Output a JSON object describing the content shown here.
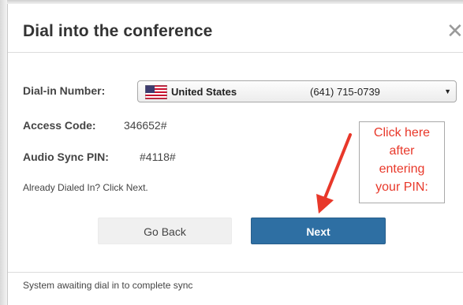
{
  "dialog": {
    "title": "Dial into the conference",
    "close_glyph": "✕",
    "dial_in_label": "Dial-in Number:",
    "dial_in": {
      "country": "United States",
      "number": "(641) 715-0739",
      "flag_icon": "us-flag-icon",
      "caret_glyph": "▼"
    },
    "access_code_label": "Access Code:",
    "access_code_value": "346652#",
    "pin_label": "Audio Sync PIN:",
    "pin_value": "#4118#",
    "hint": "Already Dialed In? Click Next.",
    "back_label": "Go Back",
    "next_label": "Next",
    "status": "System awaiting dial in to complete sync"
  },
  "annotation": {
    "lines": [
      "Click here",
      "after",
      "entering",
      "your PIN:"
    ],
    "color": "#e8382a"
  },
  "colors": {
    "primary_button": "#2e6fa3",
    "secondary_button": "#f0f0f0",
    "text": "#444444"
  }
}
